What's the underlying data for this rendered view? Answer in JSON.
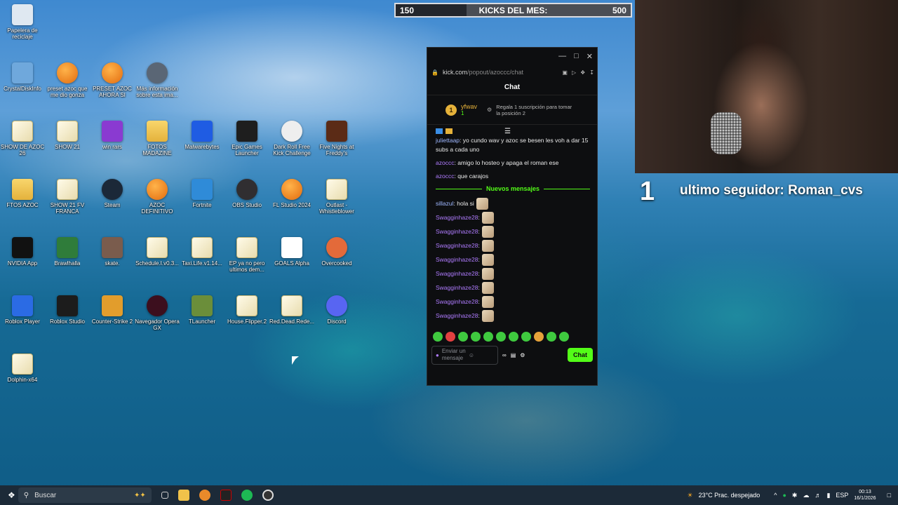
{
  "desktop_icons": [
    {
      "label": "Papelera de reciclaje",
      "icon": "recycle-bin-icon"
    },
    {
      "label": "CrystalDiskInfo",
      "icon": "crystaldiskinfo-icon"
    },
    {
      "label": "preset azoc que me dio gonza",
      "icon": "fl-studio-icon"
    },
    {
      "label": "PRESET AZOC AHORA SI",
      "icon": "fl-studio-icon"
    },
    {
      "label": "Más información sobre esta ima...",
      "icon": "info-icon"
    },
    {
      "label": "SHOW DE AZOC 26",
      "icon": "file-icon"
    },
    {
      "label": "SHOW 21",
      "icon": "file-icon"
    },
    {
      "label": "win rars",
      "icon": "winrar-icon"
    },
    {
      "label": "FOTOS MADAZINE",
      "icon": "folder-icon"
    },
    {
      "label": "Malwarebytes",
      "icon": "malwarebytes-icon"
    },
    {
      "label": "Epic Games Launcher",
      "icon": "epic-games-icon"
    },
    {
      "label": "Dark Roll Free Kick Challenge",
      "icon": "ball-icon"
    },
    {
      "label": "Five Nights at Freddy's",
      "icon": "fnaf-icon"
    },
    {
      "label": "FTOS AZOC",
      "icon": "folder-icon"
    },
    {
      "label": "SHOW 21 FV FRANCA",
      "icon": "file-icon"
    },
    {
      "label": "Steam",
      "icon": "steam-icon"
    },
    {
      "label": "AZOC DEFINITIVO",
      "icon": "fl-studio-icon"
    },
    {
      "label": "Fortnite",
      "icon": "fortnite-icon"
    },
    {
      "label": "OBS Studio",
      "icon": "obs-icon"
    },
    {
      "label": "FL Studio 2024",
      "icon": "fl-studio-icon"
    },
    {
      "label": "Outlast - Whistleblower",
      "icon": "file-icon"
    },
    {
      "label": "NVIDIA App",
      "icon": "nvidia-icon"
    },
    {
      "label": "Brawlhalla",
      "icon": "brawlhalla-icon"
    },
    {
      "label": "skate.",
      "icon": "skate-icon"
    },
    {
      "label": "Schedule.I.v0.3...",
      "icon": "file-icon"
    },
    {
      "label": "Taxi.Life.v1.14...",
      "icon": "file-icon"
    },
    {
      "label": "EP ya no pero ultimos dem...",
      "icon": "file-icon"
    },
    {
      "label": "GOALS Alpha",
      "icon": "goals-icon"
    },
    {
      "label": "Overcooked",
      "icon": "overcooked-icon"
    },
    {
      "label": "Roblox Player",
      "icon": "roblox-icon"
    },
    {
      "label": "Roblox Studio",
      "icon": "roblox-studio-icon"
    },
    {
      "label": "Counter-Strike 2",
      "icon": "cs2-icon"
    },
    {
      "label": "Navegador Opera GX",
      "icon": "opera-gx-icon"
    },
    {
      "label": "TLauncher",
      "icon": "minecraft-icon"
    },
    {
      "label": "House.Flipper.2",
      "icon": "file-icon"
    },
    {
      "label": "Red.Dead.Rede...",
      "icon": "file-icon"
    },
    {
      "label": "Discord",
      "icon": "discord-icon"
    },
    {
      "label": "Dolphin-x64",
      "icon": "file-icon"
    }
  ],
  "overlay": {
    "counter_start": "150",
    "counter_title": "KICKS DEL MES:",
    "counter_goal": "500",
    "counter_progress": 0.3,
    "big_number": "1",
    "last_follower": "ultimo seguidor: Roman_cvs"
  },
  "browser": {
    "url": "kick.com",
    "url_path": "/popout/azoccc/chat",
    "chat_title": "Chat",
    "pinned_user": "yfwav",
    "pinned_rank": "1",
    "pinned_count": "1",
    "pinned_text": "Regala 1 suscripción para tomar la posición 2",
    "messages": [
      {
        "user": "juliettaap",
        "text": ": yo cundo wav y azoc se besen les voh a dar 15 subs a cada uno"
      },
      {
        "user": "azoccc",
        "text": ": amigo lo hosteo y apaga el roman ese"
      },
      {
        "user": "azoccc",
        "text": ": que carajos"
      }
    ],
    "separator": "Nuevos mensajes",
    "new_messages": [
      {
        "user": "sillazul",
        "text": ": hola si"
      },
      {
        "user": "Swagginhaze28",
        "text": ":"
      },
      {
        "user": "Swagginhaze28",
        "text": ":"
      },
      {
        "user": "Swagginhaze28",
        "text": ":"
      },
      {
        "user": "Swagginhaze28",
        "text": ":"
      },
      {
        "user": "Swagginhaze28",
        "text": ":"
      },
      {
        "user": "Swagginhaze28",
        "text": ":"
      },
      {
        "user": "Swagginhaze28",
        "text": ":"
      },
      {
        "user": "Swagginhaze28",
        "text": ":"
      }
    ],
    "input_placeholder": "Enviar un mensaje",
    "send_label": "Chat"
  },
  "taskbar": {
    "search": "Buscar",
    "weather": "23°C  Prac. despejado",
    "lang": "ESP",
    "time": "00:13",
    "date": "16/1/2026"
  }
}
